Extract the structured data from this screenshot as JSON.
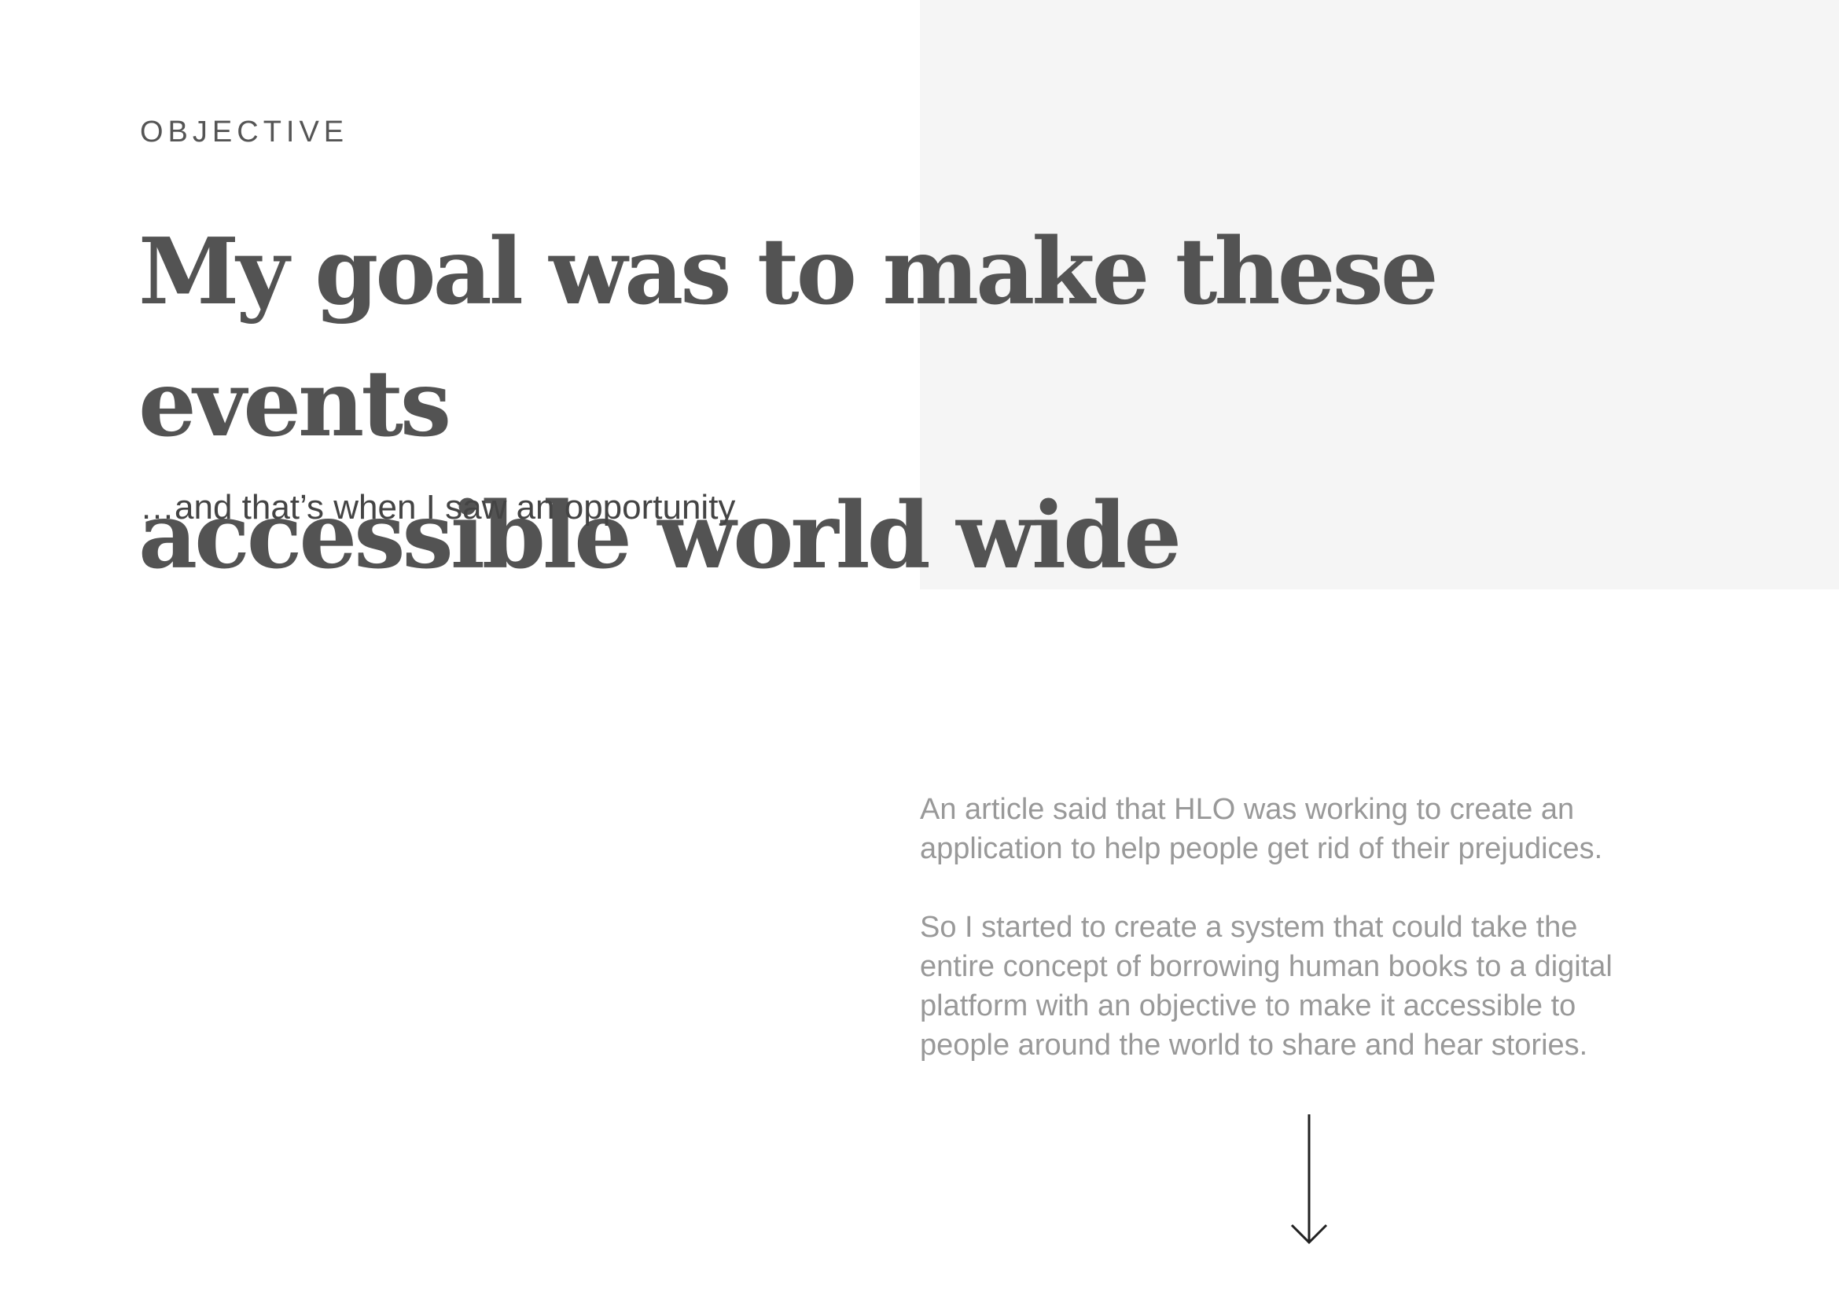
{
  "section": {
    "eyebrow": "OBJECTIVE",
    "headline_line1": "My goal was to make these events",
    "headline_line2": "accessible world wide",
    "subline": "…and that’s when I saw an opportunity"
  },
  "body": {
    "paragraph1_line1": "An article said that HLO was working to create an",
    "paragraph1_line2": "application to help people get rid of their prejudices.",
    "paragraph2_line1": "So I started to create a system that could take the",
    "paragraph2_line2": "entire concept of borrowing human books to a digital",
    "paragraph2_line3": "platform with an objective to make it accessible to",
    "paragraph2_line4": "people around the world to share and hear stories."
  },
  "icons": {
    "scroll_indicator": "arrow-down-icon"
  },
  "colors": {
    "headline": "#535353",
    "body_text": "#999999",
    "panel": "#f5f5f5"
  }
}
